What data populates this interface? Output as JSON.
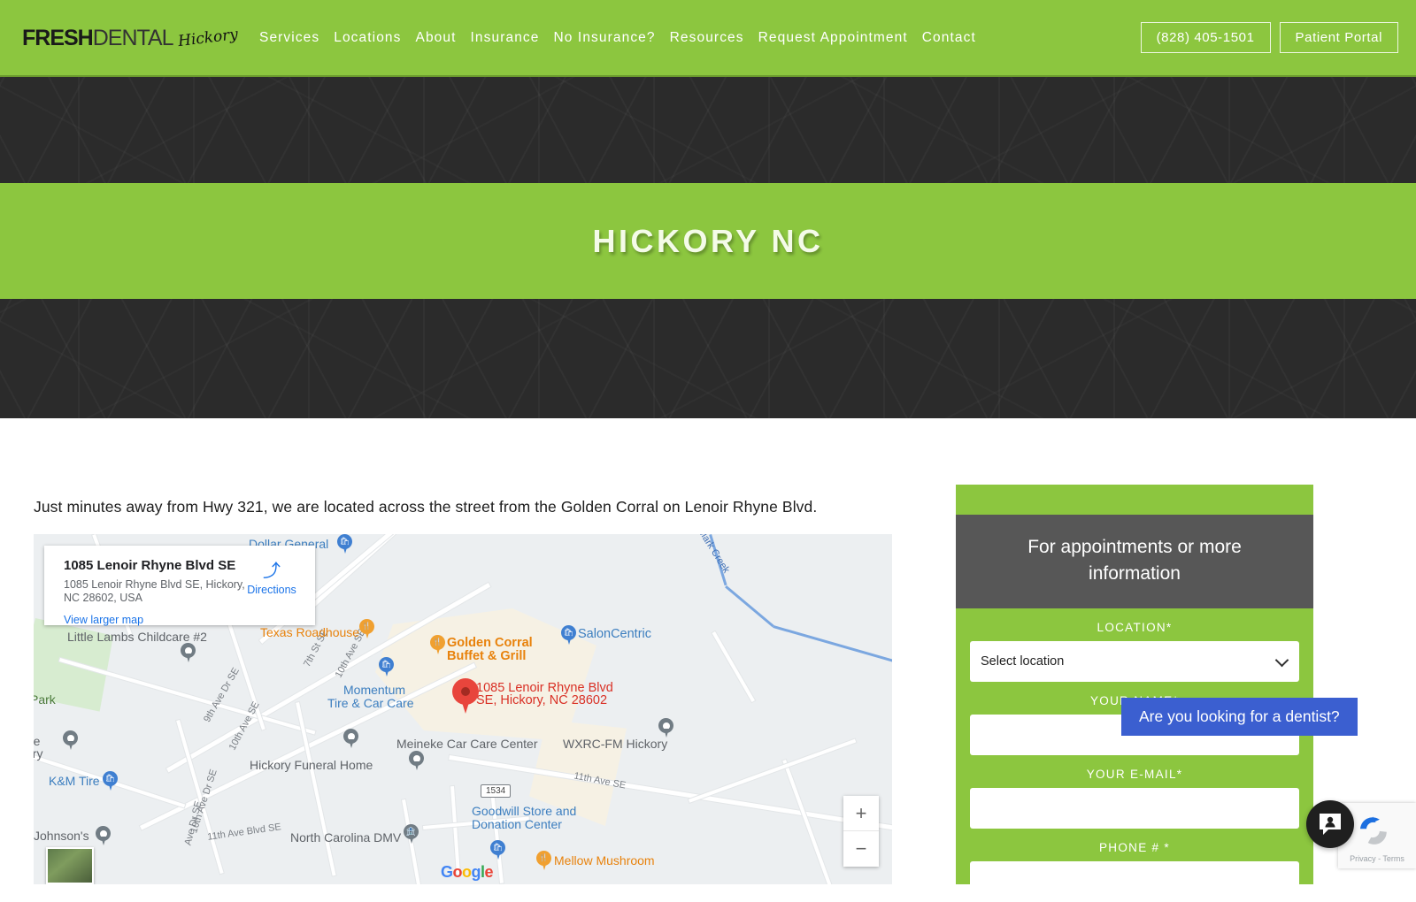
{
  "header": {
    "logo": {
      "part1": "FRESH",
      "part2": "DENTAL",
      "script": "Hickory",
      "tooth_icon": "tooth-icon"
    },
    "nav": [
      {
        "label": "Services"
      },
      {
        "label": "Locations"
      },
      {
        "label": "About"
      },
      {
        "label": "Insurance"
      },
      {
        "label": "No Insurance?"
      },
      {
        "label": "Resources"
      },
      {
        "label": "Request Appointment"
      },
      {
        "label": "Contact"
      }
    ],
    "phone_button": "(828) 405-1501",
    "portal_button": "Patient Portal",
    "bg_color": "#8cc63f"
  },
  "hero": {
    "title": "HICKORY NC",
    "band_color": "#8cc63f",
    "strip_color": "#2b2b2b"
  },
  "content": {
    "intro": "Just minutes away from Hwy 321, we are located across the street from the Golden Corral on Lenoir Rhyne Blvd."
  },
  "map": {
    "card": {
      "title": "1085 Lenoir Rhyne Blvd SE",
      "address": "1085 Lenoir Rhyne Blvd SE, Hickory, NC 28602, USA",
      "view_larger": "View larger map",
      "directions_label": "Directions",
      "directions_icon": "directions-arrow-icon"
    },
    "zoom_in": "+",
    "zoom_out": "−",
    "attribution": "Google",
    "highway_shield": "1534",
    "labels": [
      {
        "text": "Dollar General",
        "color": "blue"
      },
      {
        "text": "Little Lambs Childcare #2",
        "color": "grey"
      },
      {
        "text": "Texas Roadhouse",
        "color": "orange"
      },
      {
        "text": "Golden Corral",
        "color": "orange"
      },
      {
        "text": "Buffet & Grill",
        "color": "orange"
      },
      {
        "text": "SalonCentric",
        "color": "blue"
      },
      {
        "text": "Momentum",
        "color": "blue"
      },
      {
        "text": "Tire & Car Care",
        "color": "blue"
      },
      {
        "text": "1085 Lenoir Rhyne Blvd",
        "color": "red"
      },
      {
        "text": "SE, Hickory, NC 28602",
        "color": "red"
      },
      {
        "text": "WXRC-FM Hickory",
        "color": "grey"
      },
      {
        "text": "Meineke Car Care Center",
        "color": "grey"
      },
      {
        "text": "Hickory Funeral Home",
        "color": "grey"
      },
      {
        "text": "K&M Tire",
        "color": "blue"
      },
      {
        "text": "North Carolina DMV",
        "color": "grey"
      },
      {
        "text": "Goodwill Store and",
        "color": "blue"
      },
      {
        "text": "Donation Center",
        "color": "blue"
      },
      {
        "text": "Mellow Mushroom",
        "color": "orange"
      },
      {
        "text": "Johnson's",
        "color": "grey"
      },
      {
        "text": "Park",
        "color": "green"
      },
      {
        "text": "the",
        "color": "grey"
      },
      {
        "text": "kory",
        "color": "grey"
      }
    ],
    "streets": [
      "7th St SE",
      "10th Ave SE",
      "9th Ave Dr SE",
      "10th Ave SE",
      "10th Ave Dr SE",
      "Ave Dr SE",
      "11th Ave Blvd SE",
      "11th Ave SE",
      "Mark Creek"
    ]
  },
  "form": {
    "heading": "For appointments or more information",
    "fields": [
      {
        "label": "LOCATION*",
        "type": "select",
        "value": "Select location",
        "placeholder": ""
      },
      {
        "label": "YOUR NAME*",
        "type": "text",
        "value": "",
        "placeholder": ""
      },
      {
        "label": "YOUR E-MAIL*",
        "type": "text",
        "value": "",
        "placeholder": ""
      },
      {
        "label": "PHONE # *",
        "type": "text",
        "value": "",
        "placeholder": ""
      }
    ],
    "bg_color": "#8cc63f",
    "header_color": "#575757"
  },
  "chat": {
    "tooltip": "Are you looking for a dentist?",
    "tooltip_color": "#3b5fd0",
    "button_icon": "chat-person-icon"
  },
  "recaptcha": {
    "text": "Privacy - Terms",
    "logo_icon": "recaptcha-icon"
  }
}
